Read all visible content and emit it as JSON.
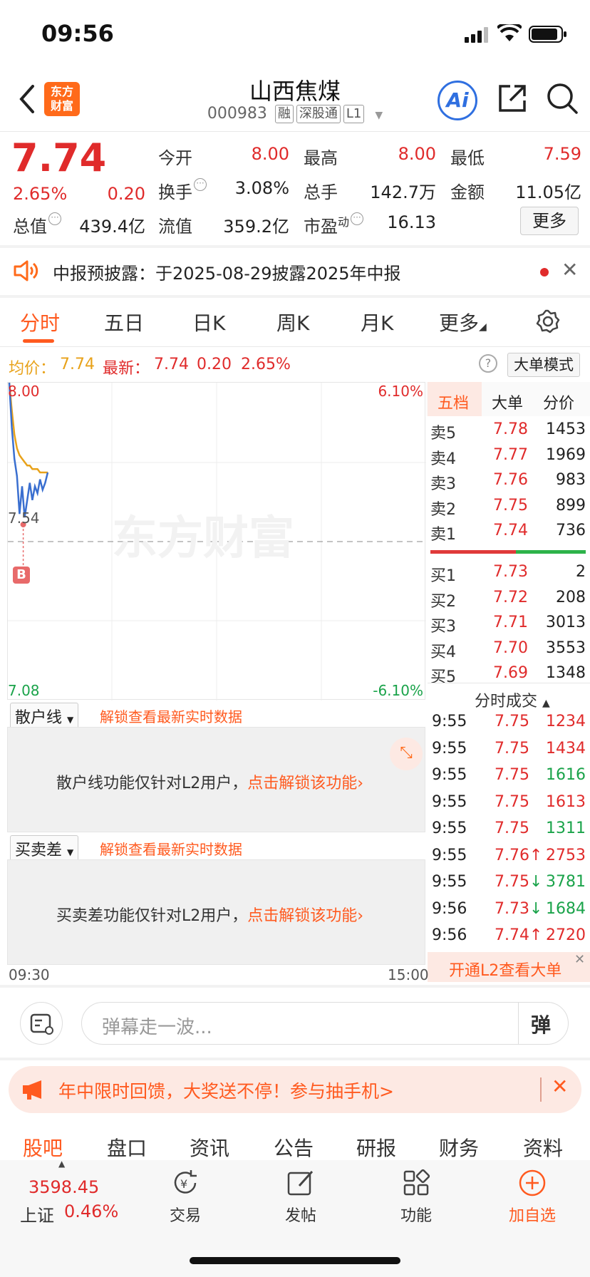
{
  "status": {
    "time": "09:56"
  },
  "header": {
    "logo_text": "东方\n财富",
    "stock_name": "山西焦煤",
    "stock_code": "000983",
    "tags": [
      "融",
      "深股通",
      "L1"
    ]
  },
  "quote": {
    "price": "7.74",
    "change_pct": "2.65%",
    "change": "0.20",
    "fields": [
      {
        "label": "今开",
        "value": "8.00",
        "color": "red"
      },
      {
        "label": "最高",
        "value": "8.00",
        "color": "red"
      },
      {
        "label": "最低",
        "value": "7.59",
        "color": "red"
      },
      {
        "label": "换手",
        "value": "3.08%",
        "color": "dark"
      },
      {
        "label": "总手",
        "value": "142.7万",
        "color": "dark"
      },
      {
        "label": "金额",
        "value": "11.05亿",
        "color": "dark"
      },
      {
        "label": "总值",
        "value": "439.4亿",
        "color": "dark"
      },
      {
        "label": "流值",
        "value": "359.2亿",
        "color": "dark"
      },
      {
        "label": "市盈",
        "sup": "动",
        "value": "16.13",
        "color": "dark"
      }
    ],
    "more_label": "更多"
  },
  "notice": {
    "text": "中报预披露：于2025-08-29披露2025年中报"
  },
  "tabs": [
    "分时",
    "五日",
    "日K",
    "周K",
    "月K",
    "更多"
  ],
  "info_row": {
    "avg_label": "均价：",
    "avg_value": "7.74",
    "latest_label": "最新：",
    "latest_value": "7.74",
    "latest_change": "0.20",
    "latest_pct": "2.65%",
    "mode_button": "大单模式"
  },
  "chart": {
    "y_top": "8.00",
    "y_mid": "7.54",
    "y_bottom": "7.08",
    "pct_top": "6.10%",
    "pct_bottom": "-6.10%",
    "watermark": "东方财富",
    "marker": "B",
    "time_start": "09:30",
    "time_end": "15:00"
  },
  "chart_data": {
    "type": "line",
    "title": "",
    "ylim": [
      7.08,
      8.0
    ],
    "reference": 7.54,
    "series": [
      {
        "name": "最新",
        "values": [
          8.0,
          7.87,
          7.78,
          7.73,
          7.62,
          7.7,
          7.61,
          7.66,
          7.71,
          7.66,
          7.7,
          7.68,
          7.72,
          7.69,
          7.71,
          7.74
        ],
        "color": "#3a6fd0"
      },
      {
        "name": "均价",
        "values": [
          8.0,
          7.92,
          7.85,
          7.81,
          7.79,
          7.78,
          7.77,
          7.76,
          7.76,
          7.75,
          7.75,
          7.75,
          7.74,
          7.74,
          7.74,
          7.74
        ],
        "color": "#e8a21a"
      }
    ]
  },
  "orderbook": {
    "tabs": [
      "五档",
      "大单",
      "分价"
    ],
    "sells": [
      {
        "label": "卖5",
        "price": "7.78",
        "vol": "1453"
      },
      {
        "label": "卖4",
        "price": "7.77",
        "vol": "1969"
      },
      {
        "label": "卖3",
        "price": "7.76",
        "vol": "983"
      },
      {
        "label": "卖2",
        "price": "7.75",
        "vol": "899"
      },
      {
        "label": "卖1",
        "price": "7.74",
        "vol": "736"
      }
    ],
    "buys": [
      {
        "label": "买1",
        "price": "7.73",
        "vol": "2"
      },
      {
        "label": "买2",
        "price": "7.72",
        "vol": "208"
      },
      {
        "label": "买3",
        "price": "7.71",
        "vol": "3013"
      },
      {
        "label": "买4",
        "price": "7.70",
        "vol": "3553"
      },
      {
        "label": "买5",
        "price": "7.69",
        "vol": "1348"
      }
    ],
    "trades_title": "分时成交",
    "trades": [
      {
        "time": "9:55",
        "price": "7.75",
        "arrow": "",
        "vol": "1234",
        "color": "red"
      },
      {
        "time": "9:55",
        "price": "7.75",
        "arrow": "",
        "vol": "1434",
        "color": "red"
      },
      {
        "time": "9:55",
        "price": "7.75",
        "arrow": "",
        "vol": "1616",
        "color": "green"
      },
      {
        "time": "9:55",
        "price": "7.75",
        "arrow": "",
        "vol": "1613",
        "color": "red"
      },
      {
        "time": "9:55",
        "price": "7.75",
        "arrow": "",
        "vol": "1311",
        "color": "green"
      },
      {
        "time": "9:55",
        "price": "7.76",
        "arrow": "↑",
        "vol": "2753",
        "color": "red"
      },
      {
        "time": "9:55",
        "price": "7.75",
        "arrow": "↓",
        "vol": "3781",
        "color": "green"
      },
      {
        "time": "9:56",
        "price": "7.73",
        "arrow": "↓",
        "vol": "1684",
        "color": "green"
      },
      {
        "time": "9:56",
        "price": "7.74",
        "arrow": "↑",
        "vol": "2720",
        "color": "red"
      }
    ],
    "l2_banner": "开通L2查看大单"
  },
  "panels": [
    {
      "select": "散户线",
      "unlock": "解锁查看最新实时数据",
      "body": "散户线功能仅针对L2用户，",
      "link": "点击解锁该功能"
    },
    {
      "select": "买卖差",
      "unlock": "解锁查看最新实时数据",
      "body": "买卖差功能仅针对L2用户，",
      "link": "点击解锁该功能"
    }
  ],
  "comment": {
    "placeholder": "弹幕走一波...",
    "danmu_label": "弹"
  },
  "promo": {
    "text": "年中限时回馈，大奖送不停！参与抽手机>"
  },
  "bottom_tabs": [
    "股吧",
    "盘口",
    "资讯",
    "公告",
    "研报",
    "财务",
    "资料"
  ],
  "bottom_nav": {
    "index_value": "3598.45",
    "index_name": "上证",
    "index_pct": "0.46%",
    "items": [
      "交易",
      "发帖",
      "功能",
      "加自选"
    ]
  }
}
